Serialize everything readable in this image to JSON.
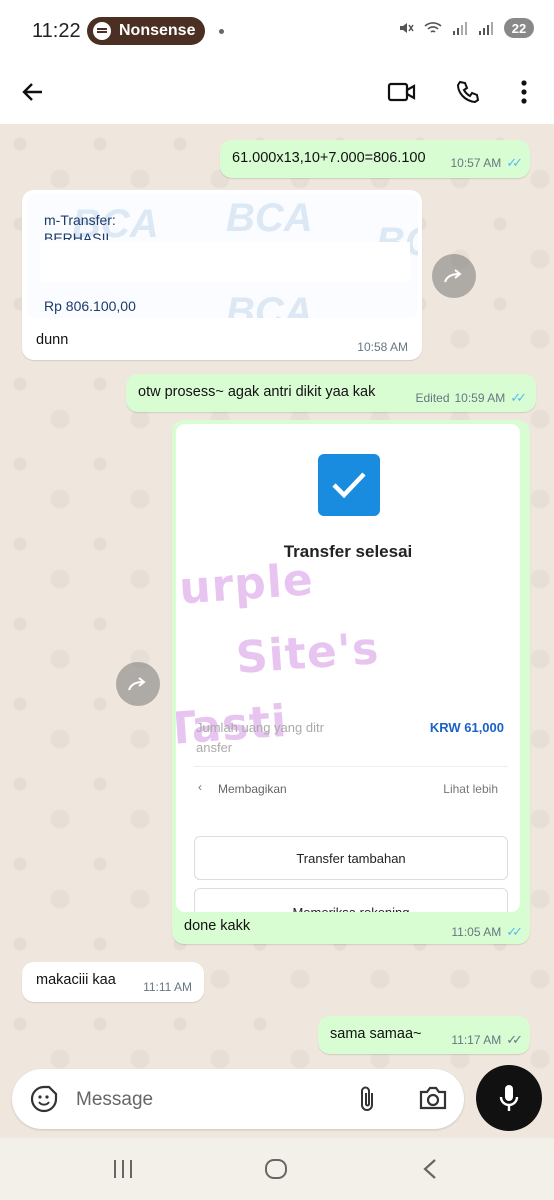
{
  "status_bar": {
    "time": "11:22",
    "media_label": "Nonsense",
    "battery": "22"
  },
  "messages": [
    {
      "text": "61.000x13,10+7.000=806.100",
      "time": "10:57 AM"
    },
    {
      "image_lines": [
        "m-Transfer:",
        "BERHASIL",
        "Rp 806.100,00"
      ],
      "image_watermark": "BCA",
      "caption": "dunn",
      "time": "10:58 AM"
    },
    {
      "text": "otw prosess~ agak antri dikit yaa kak",
      "edited": "Edited",
      "time": "10:59 AM"
    },
    {
      "image": {
        "title": "Transfer selesai",
        "field_1": "Jumlah uang yang ditr",
        "field_1b": "ansfer",
        "amount": "KRW 61,000",
        "share": "Membagikan",
        "more": "Lihat lebih",
        "button_1": "Transfer tambahan",
        "button_2": "Memeriksa rekening",
        "watermark_1": "Purple",
        "watermark_2": "Site's",
        "watermark_3": "Tasti"
      },
      "caption": "done kakk",
      "time": "11:05 AM"
    },
    {
      "text": "makaciii kaa",
      "time": "11:11 AM"
    },
    {
      "text": "sama samaa~",
      "time": "11:17 AM"
    }
  ],
  "input": {
    "placeholder": "Message"
  },
  "colors": {
    "outgoing": "#d9fdd3",
    "incoming": "#ffffff",
    "read_tick": "#53bdeb"
  }
}
